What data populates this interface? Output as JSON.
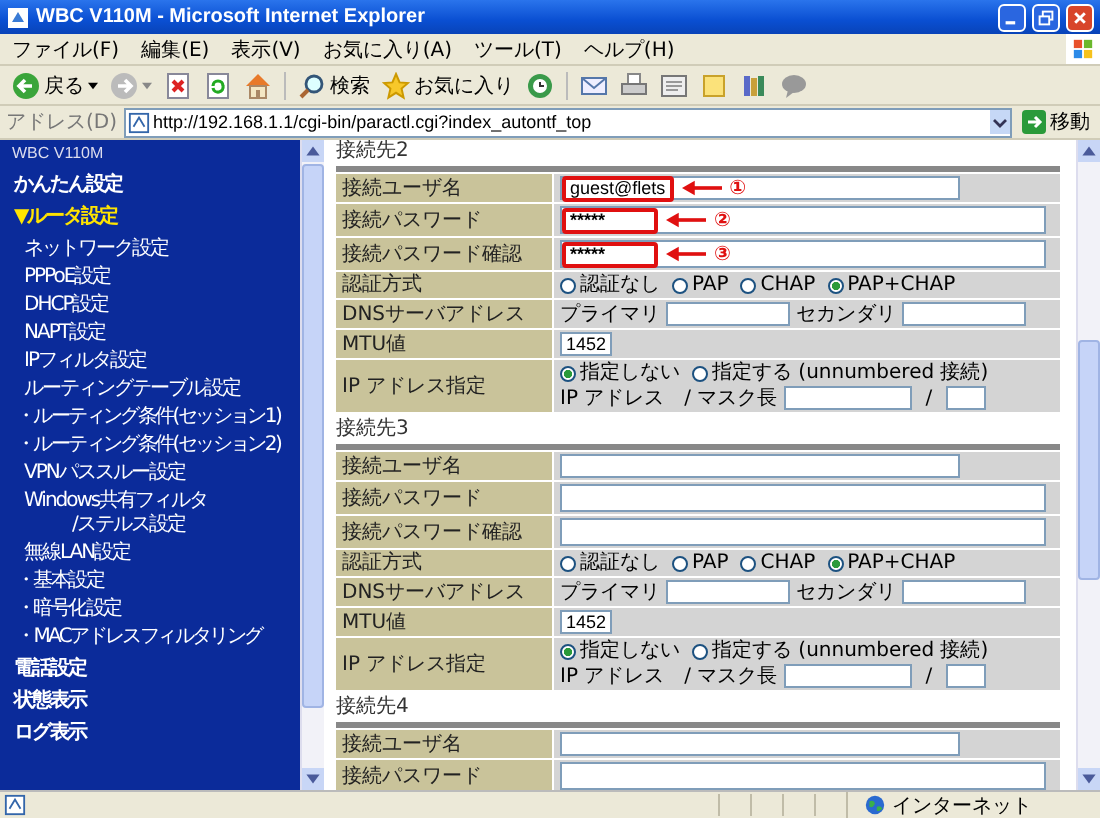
{
  "window": {
    "title": "WBC V110M - Microsoft Internet Explorer"
  },
  "menu": [
    "ファイル(F)",
    "編集(E)",
    "表示(V)",
    "お気に入り(A)",
    "ツール(T)",
    "ヘルプ(H)"
  ],
  "toolbar": {
    "back": "戻る",
    "search": "検索",
    "favorites": "お気に入り"
  },
  "address": {
    "label": "アドレス(D)",
    "url": "http://192.168.1.1/cgi-bin/paractl.cgi?index_autontf_top",
    "go": "移動"
  },
  "sidebar": {
    "title": "WBC V110M",
    "items": [
      {
        "kind": "main",
        "label": "かんたん設定",
        "selected": false
      },
      {
        "kind": "main",
        "marker": "▼",
        "label": "ルータ設定",
        "selected": true
      },
      {
        "kind": "sub",
        "label": "ネットワーク設定",
        "selected": false
      },
      {
        "kind": "sub",
        "label": "PPPoE設定",
        "selected": false
      },
      {
        "kind": "sub",
        "label": "DHCP設定",
        "selected": false
      },
      {
        "kind": "sub",
        "label": "NAPT設定",
        "selected": false
      },
      {
        "kind": "sub",
        "label": "IPフィルタ設定",
        "selected": false
      },
      {
        "kind": "sub",
        "label": "ルーティングテーブル設定",
        "selected": false
      },
      {
        "kind": "subsub",
        "label": "・ルーティング条件(セッション1)",
        "selected": false
      },
      {
        "kind": "subsub",
        "label": "・ルーティング条件(セッション2)",
        "selected": false
      },
      {
        "kind": "sub",
        "label": "VPNパススルー設定",
        "selected": false
      },
      {
        "kind": "sub",
        "label": "Windows共有フィルタ",
        "label_2": "/ステルス設定",
        "selected": false
      },
      {
        "kind": "sub",
        "label": "無線LAN設定",
        "selected": false
      },
      {
        "kind": "subsub",
        "label": "・基本設定",
        "selected": false
      },
      {
        "kind": "subsub",
        "label": "・暗号化設定",
        "selected": false
      },
      {
        "kind": "subsub",
        "label": "・MACアドレスフィルタリング",
        "selected": false
      },
      {
        "kind": "main",
        "label": "電話設定",
        "selected": false
      },
      {
        "kind": "main",
        "label": "状態表示",
        "selected": false
      },
      {
        "kind": "main",
        "label": "ログ表示",
        "selected": false
      }
    ]
  },
  "sections": [
    {
      "title": "接続先2",
      "rows": [
        {
          "kind": "username",
          "label": "接続ユーザ名",
          "value": "guest@flets",
          "highlight": true,
          "annotation": "①"
        },
        {
          "kind": "password",
          "label": "接続パスワード",
          "value": "*****",
          "highlight": true,
          "annotation": "②"
        },
        {
          "kind": "password",
          "label": "接続パスワード確認",
          "value": "*****",
          "highlight": true,
          "annotation": "③"
        },
        {
          "kind": "radio",
          "label": "認証方式",
          "options": [
            {
              "label": "認証なし",
              "selected": false
            },
            {
              "label": "PAP",
              "selected": false
            },
            {
              "label": "CHAP",
              "selected": false
            },
            {
              "label": "PAP+CHAP",
              "selected": true
            }
          ]
        },
        {
          "kind": "dns",
          "label": "DNSサーバアドレス",
          "fields": [
            {
              "label": "プライマリ"
            },
            {
              "label": "セカンダリ"
            }
          ]
        },
        {
          "kind": "mtu",
          "label": "MTU値",
          "value": "1452"
        },
        {
          "kind": "ip",
          "label": "IP アドレス指定",
          "options": [
            {
              "label": "指定しない",
              "selected": true
            },
            {
              "label": "指定する (unnumbered 接続)",
              "selected": false
            }
          ],
          "address_label": "IP アドレス　/ マスク長",
          "separator": "/"
        }
      ]
    },
    {
      "title": "接続先3",
      "rows": [
        {
          "kind": "username",
          "label": "接続ユーザ名"
        },
        {
          "kind": "password",
          "label": "接続パスワード"
        },
        {
          "kind": "password",
          "label": "接続パスワード確認"
        },
        {
          "kind": "radio",
          "label": "認証方式",
          "options": [
            {
              "label": "認証なし",
              "selected": false
            },
            {
              "label": "PAP",
              "selected": false
            },
            {
              "label": "CHAP",
              "selected": false
            },
            {
              "label": "PAP+CHAP",
              "selected": true
            }
          ]
        },
        {
          "kind": "dns",
          "label": "DNSサーバアドレス",
          "fields": [
            {
              "label": "プライマリ"
            },
            {
              "label": "セカンダリ"
            }
          ]
        },
        {
          "kind": "mtu",
          "label": "MTU値",
          "value": "1452"
        },
        {
          "kind": "ip",
          "label": "IP アドレス指定",
          "options": [
            {
              "label": "指定しない",
              "selected": true
            },
            {
              "label": "指定する (unnumbered 接続)",
              "selected": false
            }
          ],
          "address_label": "IP アドレス　/ マスク長",
          "separator": "/"
        }
      ]
    },
    {
      "title": "接続先4",
      "rows": [
        {
          "kind": "username",
          "label": "接続ユーザ名"
        },
        {
          "kind": "password",
          "label": "接続パスワード"
        }
      ]
    }
  ],
  "status_bar": {
    "zone": "インターネット"
  }
}
